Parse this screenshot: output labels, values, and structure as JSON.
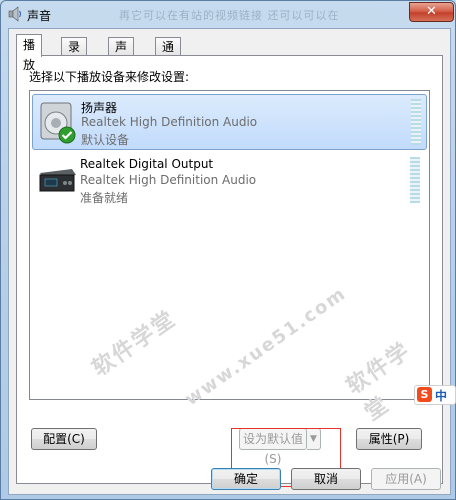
{
  "window": {
    "title": "声音",
    "top_watermark": "再它可以在有站的视频链接 还可以可以在"
  },
  "tabs": [
    {
      "label": "播放",
      "active": true
    },
    {
      "label": "录制",
      "active": false
    },
    {
      "label": "声音",
      "active": false
    },
    {
      "label": "通信",
      "active": false
    }
  ],
  "instruction": "选择以下播放设备来修改设置:",
  "devices": [
    {
      "name": "扬声器",
      "driver": "Realtek High Definition Audio",
      "status": "默认设备",
      "selected": true,
      "icon": "speaker-icon",
      "default_badge": "check-icon"
    },
    {
      "name": "Realtek Digital Output",
      "driver": "Realtek High Definition Audio",
      "status": "准备就绪",
      "selected": false,
      "icon": "digital-output-icon"
    }
  ],
  "buttons": {
    "configure": "配置(C)",
    "set_default": "设为默认值(S)",
    "properties": "属性(P)",
    "ok": "确定",
    "cancel": "取消",
    "apply": "应用(A)"
  },
  "watermark": {
    "text1": "软件学堂",
    "text2": "www.xue51.com"
  },
  "ime": {
    "logo": "S",
    "mode": "中"
  },
  "colors": {
    "highlight_box": "#e8322c",
    "selection": "#c1dbfc",
    "close_button": "#c2412a"
  }
}
